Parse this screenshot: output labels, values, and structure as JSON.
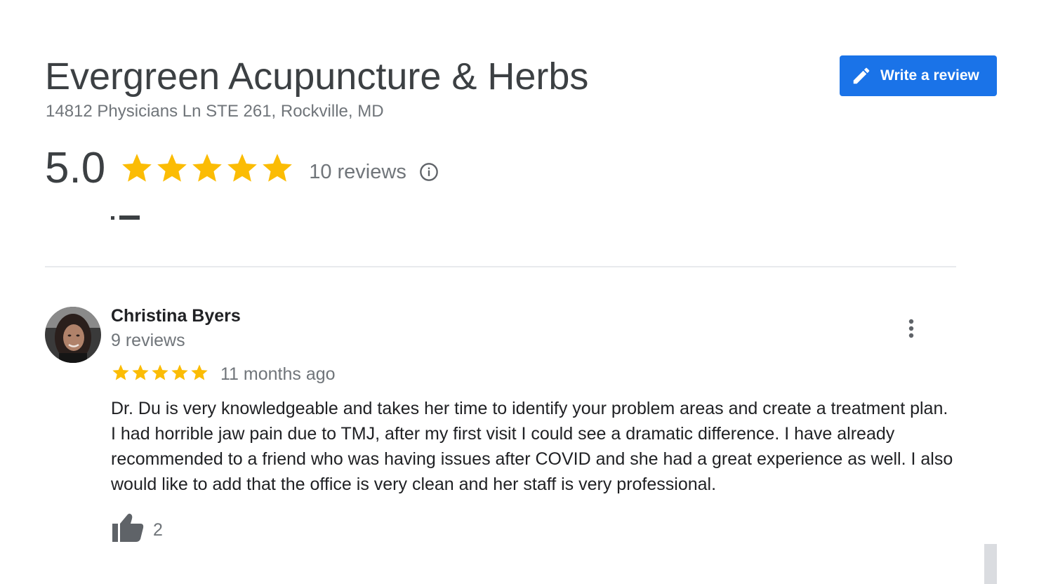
{
  "business": {
    "name": "Evergreen Acupuncture & Herbs",
    "address": "14812 Physicians Ln STE 261, Rockville, MD"
  },
  "actions": {
    "write_review_label": "Write a review"
  },
  "summary": {
    "rating": "5.0",
    "stars": 5,
    "review_count": "10 reviews"
  },
  "review": {
    "author": "Christina Byers",
    "author_reviews": "9 reviews",
    "stars": 5,
    "time": "11 months ago",
    "text": "Dr. Du is very knowledgeable and takes her time to identify your problem areas and create a treatment plan. I had horrible jaw pain due to TMJ, after my first visit I could see a dramatic difference. I have already recommended to a friend who was having issues after COVID and she had a great experience as well. I also would like to add that the office is very clean and her staff is very professional.",
    "likes": "2"
  },
  "colors": {
    "accent": "#1a73e8",
    "star": "#fbbc04",
    "muted_text": "#70757a",
    "icon_gray": "#5f6368"
  },
  "icons": {
    "write": "pencil-icon",
    "info": "info-icon",
    "more": "more-vert-icon",
    "like": "thumb-up-icon",
    "star": "star-icon"
  }
}
